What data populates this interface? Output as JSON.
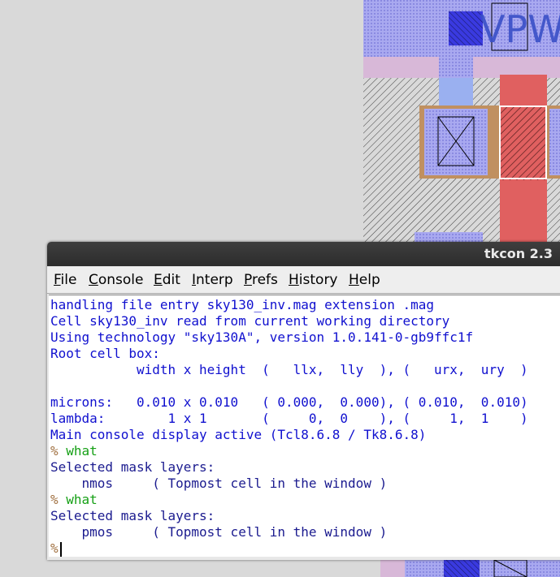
{
  "window": {
    "title": "tkcon 2.3"
  },
  "menu": [
    {
      "hot": "F",
      "rest": "ile"
    },
    {
      "hot": "C",
      "rest": "onsole"
    },
    {
      "hot": "E",
      "rest": "dit"
    },
    {
      "hot": "I",
      "rest": "nterp"
    },
    {
      "hot": "P",
      "rest": "refs"
    },
    {
      "hot": "H",
      "rest": "istory"
    },
    {
      "hot": "H",
      "rest": "elp"
    }
  ],
  "console": {
    "lines": [
      "handling file entry sky130_inv.mag extension .mag",
      "Cell sky130_inv read from current working directory",
      "Using technology \"sky130A\", version 1.0.141-0-gb9ffc1f",
      "Root cell box:",
      "           width x height  (   llx,  lly  ), (   urx,  ury  )",
      "",
      "microns:   0.010 x 0.010   ( 0.000,  0.000), ( 0.010,  0.010)",
      "lambda:        1 x 1       (     0,  0    ), (     1,  1    )",
      "Main console display active (Tcl8.6.8 / Tk8.6.8)"
    ],
    "prompt": "%",
    "cmd1": "what",
    "out1_header": "Selected mask layers:",
    "out1_layer": "    nmos     ( Topmost cell in the window )",
    "cmd2": "what",
    "out2_header": "Selected mask layers:",
    "out2_layer": "    pmos     ( Topmost cell in the window )"
  },
  "layout_view": {
    "label": "VPW"
  },
  "colors": {
    "nwell_fill": "#a9a9f0",
    "poly": "#e06060",
    "diffusion": "#c09060",
    "metal": "#8080f0",
    "console_text": "#1010cf",
    "command_text": "#16a016",
    "prompt": "#a07040"
  }
}
